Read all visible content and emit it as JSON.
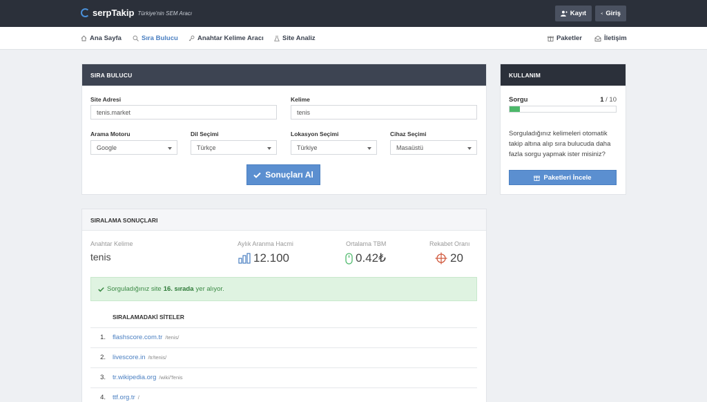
{
  "header": {
    "logo_text": "serpTakip",
    "logo_sub": "Türkiye'nin SEM Aracı",
    "register_label": "Kayıt",
    "login_label": "Giriş"
  },
  "nav": {
    "home": "Ana Sayfa",
    "rank_finder": "Sıra Bulucu",
    "keyword_tool": "Anahtar Kelime Aracı",
    "site_analysis": "Site Analiz",
    "packages": "Paketler",
    "contact": "İletişim"
  },
  "form": {
    "title": "SIRA BULUCU",
    "site_label": "Site Adresi",
    "site_value": "tenis.market",
    "keyword_label": "Kelime",
    "keyword_value": "tenis",
    "engine_label": "Arama Motoru",
    "engine_value": "Google",
    "language_label": "Dil Seçimi",
    "language_value": "Türkçe",
    "location_label": "Lokasyon Seçimi",
    "location_value": "Türkiye",
    "device_label": "Cihaz Seçimi",
    "device_value": "Masaüstü",
    "submit_label": "Sonuçları Al"
  },
  "usage": {
    "title": "KULLANIM",
    "query_label": "Sorgu",
    "used": "1",
    "limit": "/ 10",
    "progress": 0.1,
    "promo_text": "Sorguladığınız kelimeleri otomatik takip altına alıp sıra bulucuda daha fazla sorgu yapmak ister misiniz?",
    "button_label": "Paketleri İncele"
  },
  "results": {
    "title": "SIRALAMA SONUÇLARI",
    "keyword_label": "Anahtar Kelime",
    "keyword_value": "tenis",
    "volume_label": "Aylık Aranma Hacmi",
    "volume_value": "12.100",
    "cpc_label": "Ortalama TBM",
    "cpc_value": "0.42₺",
    "competition_label": "Rekabet Oranı",
    "competition_value": "20",
    "alert_pre": "Sorguladığınız site",
    "alert_rank": "16. sırada",
    "alert_post": "yer alıyor.",
    "list_title": "SIRALAMADAKİ SİTELER",
    "rows": [
      {
        "num": "1.",
        "domain": "flashscore.com.tr",
        "path": "/tenis/"
      },
      {
        "num": "2.",
        "domain": "livescore.in",
        "path": "/tr/tenis/"
      },
      {
        "num": "3.",
        "domain": "tr.wikipedia.org",
        "path": "/wiki/Tenis"
      },
      {
        "num": "4.",
        "domain": "ttf.org.tr",
        "path": "/"
      }
    ]
  },
  "colors": {
    "topbar": "#2b303a",
    "accent": "#5b8fd0",
    "success": "#4cb86a"
  }
}
